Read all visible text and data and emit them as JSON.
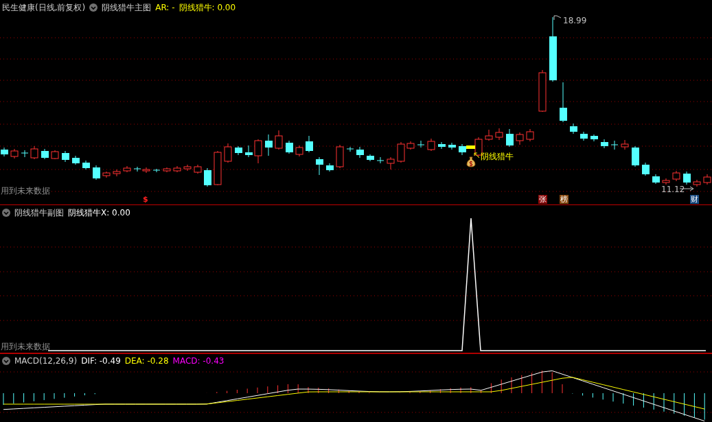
{
  "main_chart": {
    "stock": "民生健康(日线,前复权)",
    "indicator": "阴线猎牛主图",
    "readings": [
      {
        "label": "AR: -",
        "color": "#ffff00"
      },
      {
        "label": "阴线猎牛: 0.00",
        "color": "#ffff00"
      }
    ],
    "high_label": "18.99",
    "low_label": "11.12",
    "signal_label": "阴线猎牛",
    "future_data_note": "用到未来数据",
    "markers": [
      {
        "text": "$",
        "color": "#ff2020"
      },
      {
        "text": "张",
        "color": "#8a0a0a"
      },
      {
        "text": "榜",
        "color": "#8a4a10"
      },
      {
        "text": "财",
        "color": "#1a4a80"
      }
    ]
  },
  "sub_chart": {
    "indicator": "阴线猎牛副图",
    "readings": [
      {
        "label": "阴线猎牛X: 0.00",
        "color": "#ffffff"
      }
    ],
    "future_data_note": "用到未来数据"
  },
  "macd_chart": {
    "indicator": "MACD(12,26,9)",
    "readings": [
      {
        "label": "DIF: -0.49",
        "color": "#ffffff"
      },
      {
        "label": "DEA: -0.28",
        "color": "#ffff00"
      },
      {
        "label": "MACD: -0.43",
        "color": "#ff00ff"
      }
    ]
  }
}
